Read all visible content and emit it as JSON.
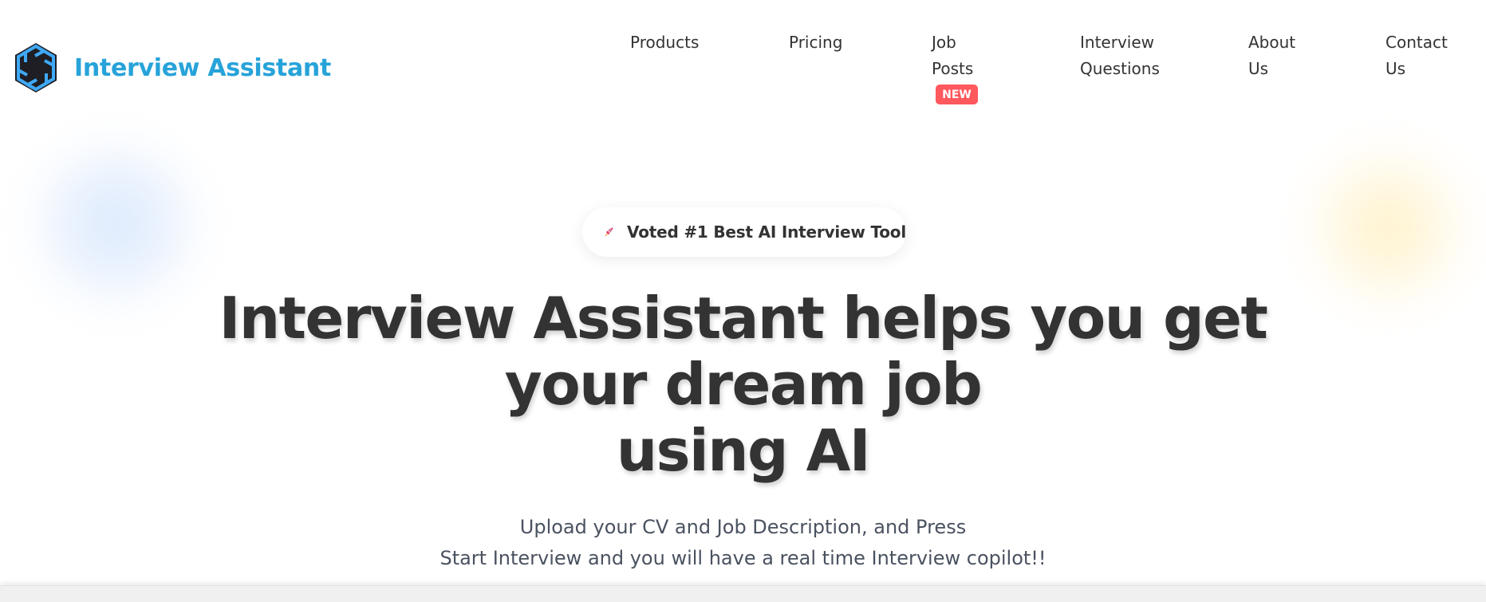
{
  "header": {
    "brand_name": "Interview Assistant",
    "logo_icon": "hexagon-spiral-logo",
    "colors": {
      "brand": "#27a3d9",
      "logo_dark": "#1e1e24",
      "logo_light": "#3fa9f5"
    }
  },
  "nav": {
    "items": [
      {
        "lines": [
          "Products"
        ]
      },
      {
        "lines": [
          "Pricing"
        ]
      },
      {
        "lines": [
          "Job",
          "Posts"
        ],
        "badge": "NEW"
      },
      {
        "lines": [
          "Interview",
          "Questions"
        ]
      },
      {
        "lines": [
          "About",
          "Us"
        ]
      },
      {
        "lines": [
          "Contact",
          "Us"
        ]
      }
    ],
    "badge_color": "#ff585d"
  },
  "hero": {
    "pill": {
      "icon": "rocket-icon",
      "text": "Voted #1 Best AI Interview Tool"
    },
    "headline_lines": [
      "Interview Assistant helps you get",
      "your dream job",
      "using AI"
    ],
    "subtitle_lines": [
      "Upload your CV and Job Description, and Press",
      "Start Interview and you will have a real time Interview copilot!!"
    ]
  }
}
